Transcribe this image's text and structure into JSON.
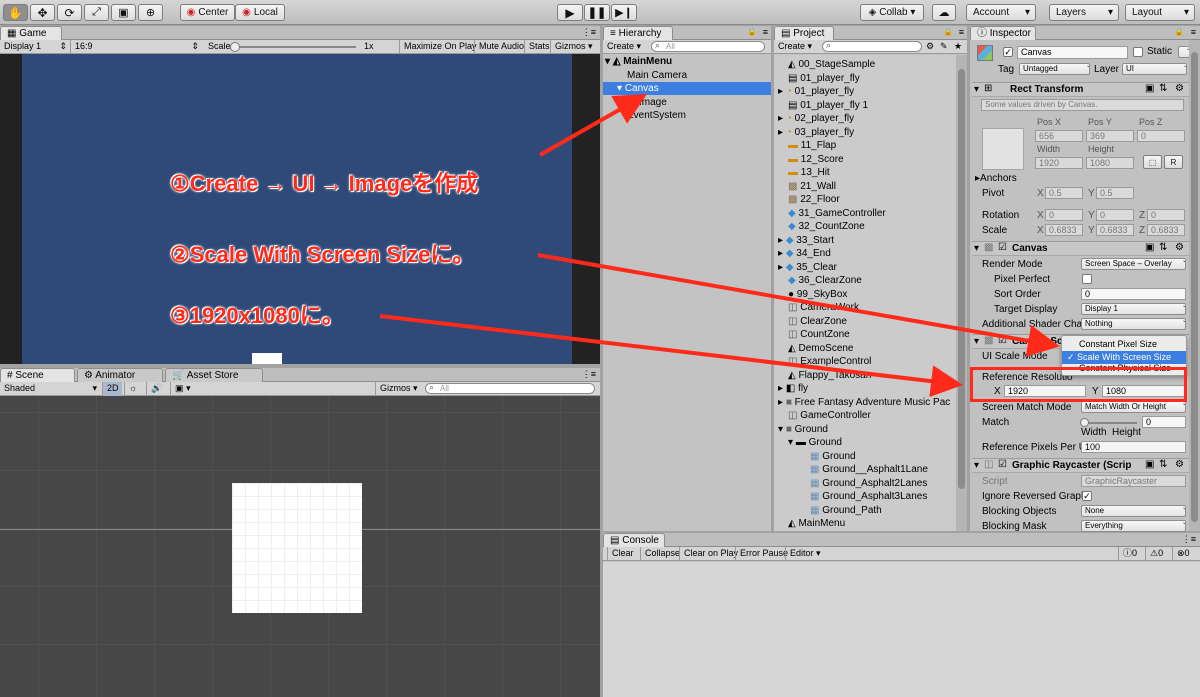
{
  "toolbar": {
    "center": "Center",
    "local": "Local",
    "collab": "Collab ▾",
    "account": "Account",
    "layers": "Layers",
    "layout": "Layout"
  },
  "game": {
    "tab": "Game",
    "display": "Display 1",
    "aspect": "16:9",
    "scale_label": "Scale",
    "scale_value": "1x",
    "maximize": "Maximize On Play",
    "mute": "Mute Audio",
    "stats": "Stats",
    "gizmos": "Gizmos ▾"
  },
  "scene": {
    "tab_scene": "Scene",
    "tab_animator": "Animator",
    "tab_asset_store": "Asset Store",
    "shaded": "Shaded",
    "mode_2d": "2D",
    "gizmos": "Gizmos ▾",
    "search_placeholder": "All"
  },
  "hierarchy": {
    "tab": "Hierarchy",
    "create": "Create ▾",
    "search_placeholder": "All",
    "items": [
      "MainMenu",
      "Main Camera",
      "Canvas",
      "Image",
      "EventSystem"
    ]
  },
  "project": {
    "tab": "Project",
    "create": "Create ▾",
    "items": [
      "00_StageSample",
      "01_player_fly",
      "01_player_fly",
      "01_player_fly 1",
      "02_player_fly",
      "03_player_fly",
      "11_Flap",
      "12_Score",
      "13_Hit",
      "21_Wall",
      "22_Floor",
      "31_GameController",
      "32_CountZone",
      "33_Start",
      "34_End",
      "35_Clear",
      "36_ClearZone",
      "99_SkyBox",
      "CameraWork",
      "ClearZone",
      "CountZone",
      "DemoScene",
      "ExampleControl",
      "Flappy_Takosan",
      "fly",
      "Free Fantasy Adventure Music Pac",
      "GameController",
      "Ground",
      "Ground",
      "Ground",
      "Ground__Asphalt1Lane",
      "Ground_Asphalt2Lanes",
      "Ground_Asphalt3Lanes",
      "Ground_Path",
      "MainMenu"
    ]
  },
  "console": {
    "tab": "Console",
    "clear": "Clear",
    "collapse": "Collapse",
    "clear_on_play": "Clear on Play",
    "error_pause": "Error Pause",
    "editor": "Editor ▾",
    "count_info": "0",
    "count_warn": "0",
    "count_error": "0"
  },
  "inspector": {
    "tab": "Inspector",
    "object_name": "Canvas",
    "static": "Static",
    "tag_label": "Tag",
    "tag": "Untagged",
    "layer_label": "Layer",
    "layer": "UI",
    "rect_transform": {
      "title": "Rect Transform",
      "note": "Some values driven by Canvas.",
      "pos_x_label": "Pos X",
      "pos_y_label": "Pos Y",
      "pos_z_label": "Pos Z",
      "pos_x": "656",
      "pos_y": "369",
      "pos_z": "0",
      "width_label": "Width",
      "height_label": "Height",
      "width": "1920",
      "height": "1080",
      "r_button": "R",
      "anchors": "Anchors",
      "pivot": "Pivot",
      "pivot_x": "0.5",
      "pivot_y": "0.5",
      "rotation": "Rotation",
      "rot_x": "0",
      "rot_y": "0",
      "rot_z": "0",
      "scale": "Scale",
      "scale_x": "0.6833",
      "scale_y": "0.6833",
      "scale_z": "0.6833"
    },
    "canvas": {
      "title": "Canvas",
      "render_mode_label": "Render Mode",
      "render_mode": "Screen Space – Overlay",
      "pixel_perfect": "Pixel Perfect",
      "sort_order_label": "Sort Order",
      "sort_order": "0",
      "target_display_label": "Target Display",
      "target_display": "Display 1",
      "shader_channels_label": "Additional Shader Cha",
      "shader_channels": "Nothing"
    },
    "canvas_scaler": {
      "title": "Canvas Sca",
      "ui_scale_mode_label": "UI Scale Mode",
      "ref_resolution_label": "Reference Resolutio",
      "x_label": "X",
      "x": "1920",
      "y_label": "Y",
      "y": "1080",
      "screen_match_label": "Screen Match Mode",
      "screen_match": "Match Width Or Height",
      "match_label": "Match",
      "match_value": "0",
      "width_label": "Width",
      "height_label": "Height",
      "ref_pixels_label": "Reference Pixels Per U",
      "ref_pixels": "100"
    },
    "raycaster": {
      "title": "Graphic Raycaster (Scrip",
      "script_label": "Script",
      "script": "GraphicRaycaster",
      "ignore_reversed": "Ignore Reversed Graph",
      "blocking_objects_label": "Blocking Objects",
      "blocking_objects": "None",
      "blocking_mask_label": "Blocking Mask",
      "blocking_mask": "Everything"
    },
    "dropdown": {
      "options": [
        "Constant Pixel Size",
        "Scale With Screen Size",
        "Constant Physical Size"
      ],
      "selected": "Scale With Screen Size"
    }
  },
  "annotations": {
    "step1": "①Create → UI → Imageを作成",
    "step2": "②Scale With Screen Sizeに。",
    "step3": "③1920x1080に。"
  },
  "colors": {
    "game_bg": "#2f4a78",
    "scene_bg": "#474747",
    "annotation_red": "#ff2a1a",
    "selection_blue": "#3d7fe0"
  }
}
